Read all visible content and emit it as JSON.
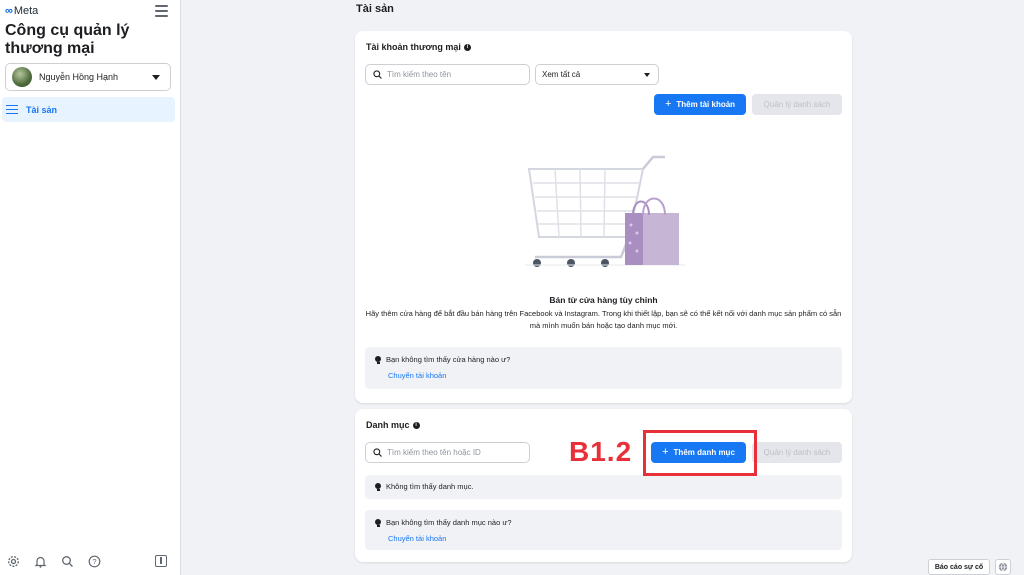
{
  "sidebar": {
    "logo_text": "Meta",
    "app_title": "Công cụ quản lý thương mại",
    "account_name": "Nguyễn Hồng Hạnh",
    "nav_items": [
      {
        "label": "Tài sản"
      }
    ]
  },
  "main": {
    "page_title": "Tài sản",
    "commerce_accounts": {
      "title": "Tài khoản thương mại",
      "search_placeholder": "Tìm kiếm theo tên",
      "filter_value": "Xem tất cả",
      "add_button": "Thêm tài khoản",
      "manage_button": "Quản lý danh sách",
      "empty_title": "Bán từ cửa hàng tùy chỉnh",
      "empty_desc": "Hãy thêm cửa hàng để bắt đầu bán hàng trên Facebook và Instagram. Trong khi thiết lập, bạn sẽ có thể kết nối với danh mục sản phẩm có sẵn mà mình muốn bán hoặc tạo danh mục mới.",
      "tip_text": "Bạn không tìm thấy cửa hàng nào ư?",
      "tip_link": "Chuyển tài khoản"
    },
    "catalogs": {
      "title": "Danh mục",
      "search_placeholder": "Tìm kiếm theo tên hoặc ID",
      "add_button": "Thêm danh mục",
      "manage_button": "Quản lý danh sách",
      "empty_text": "Không tìm thấy danh mục.",
      "tip_text": "Bạn không tìm thấy danh mục nào ư?",
      "tip_link": "Chuyển tài khoản"
    }
  },
  "annotation": {
    "label": "B1.2",
    "color": "#e8303a"
  },
  "footer": {
    "report_button": "Báo cáo sự cố"
  },
  "colors": {
    "accent": "#1877f2",
    "background": "#f0f2f5"
  }
}
